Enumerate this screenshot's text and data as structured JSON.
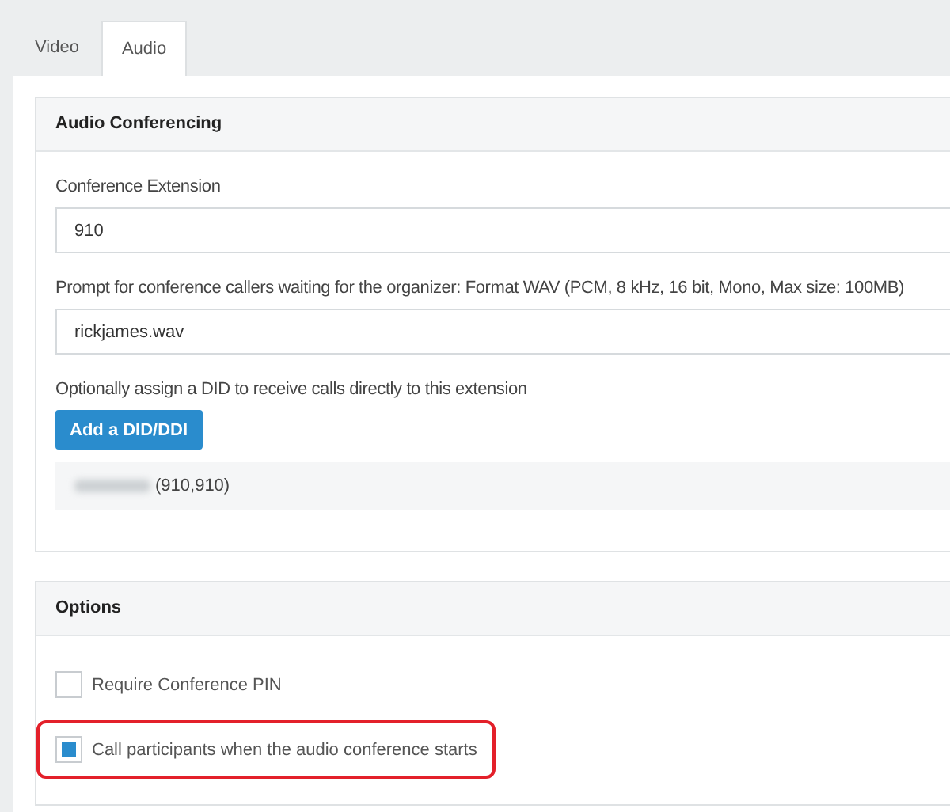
{
  "tabs": [
    {
      "label": "Video",
      "selected": false
    },
    {
      "label": "Audio",
      "selected": true
    }
  ],
  "audio_conferencing": {
    "title": "Audio Conferencing",
    "fields": [
      {
        "label": "Conference Extension",
        "value": "910"
      },
      {
        "label": "Prompt for conference callers waiting for the organizer: Format WAV (PCM, 8 kHz, 16 bit, Mono, Max size: 100MB)",
        "value": "rickjames.wav"
      }
    ],
    "did_hint": "Optionally assign a DID to receive calls directly to this extension",
    "add_button": "Add a DID/DDI",
    "dids": [
      {
        "number_redacted": true,
        "extensions": "(910,910)"
      }
    ]
  },
  "options": {
    "title": "Options",
    "items": [
      {
        "label": "Require Conference PIN",
        "checked": false,
        "highlighted": false
      },
      {
        "label": "Call participants when the audio conference starts",
        "checked": true,
        "highlighted": true
      }
    ]
  }
}
